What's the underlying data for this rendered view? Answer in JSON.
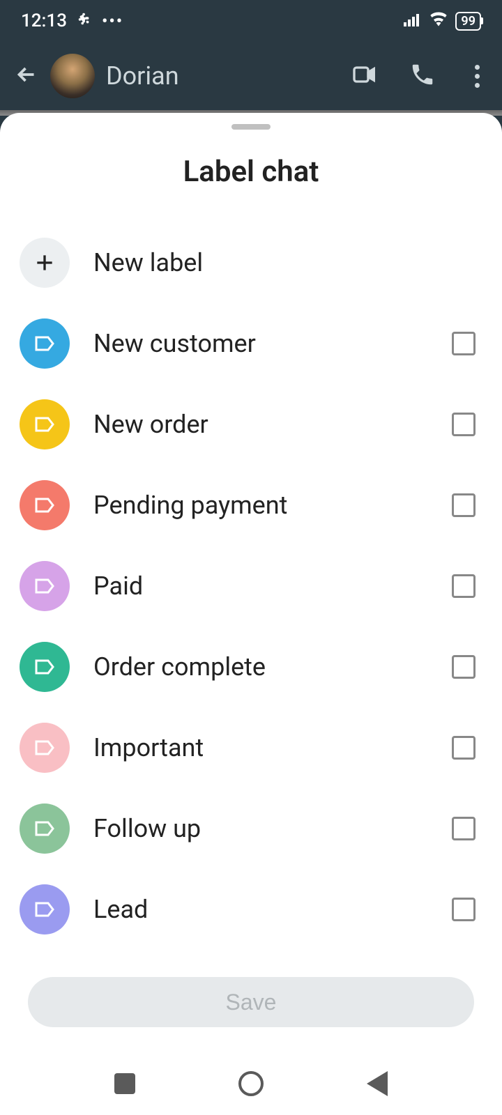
{
  "status": {
    "time": "12:13",
    "battery": "99"
  },
  "header": {
    "contact_name": "Dorian"
  },
  "sheet": {
    "title": "Label chat",
    "new_label": "New label",
    "save_label": "Save"
  },
  "labels": [
    {
      "name": "New customer",
      "color": "#35a9e1",
      "checked": false
    },
    {
      "name": "New order",
      "color": "#f5c518",
      "checked": false
    },
    {
      "name": "Pending payment",
      "color": "#f47a6b",
      "checked": false
    },
    {
      "name": "Paid",
      "color": "#d6a3e8",
      "checked": false
    },
    {
      "name": "Order complete",
      "color": "#2fb893",
      "checked": false
    },
    {
      "name": "Important",
      "color": "#f9bfc4",
      "checked": false
    },
    {
      "name": "Follow up",
      "color": "#8bc49a",
      "checked": false
    },
    {
      "name": "Lead",
      "color": "#9a9bf0",
      "checked": false
    }
  ]
}
